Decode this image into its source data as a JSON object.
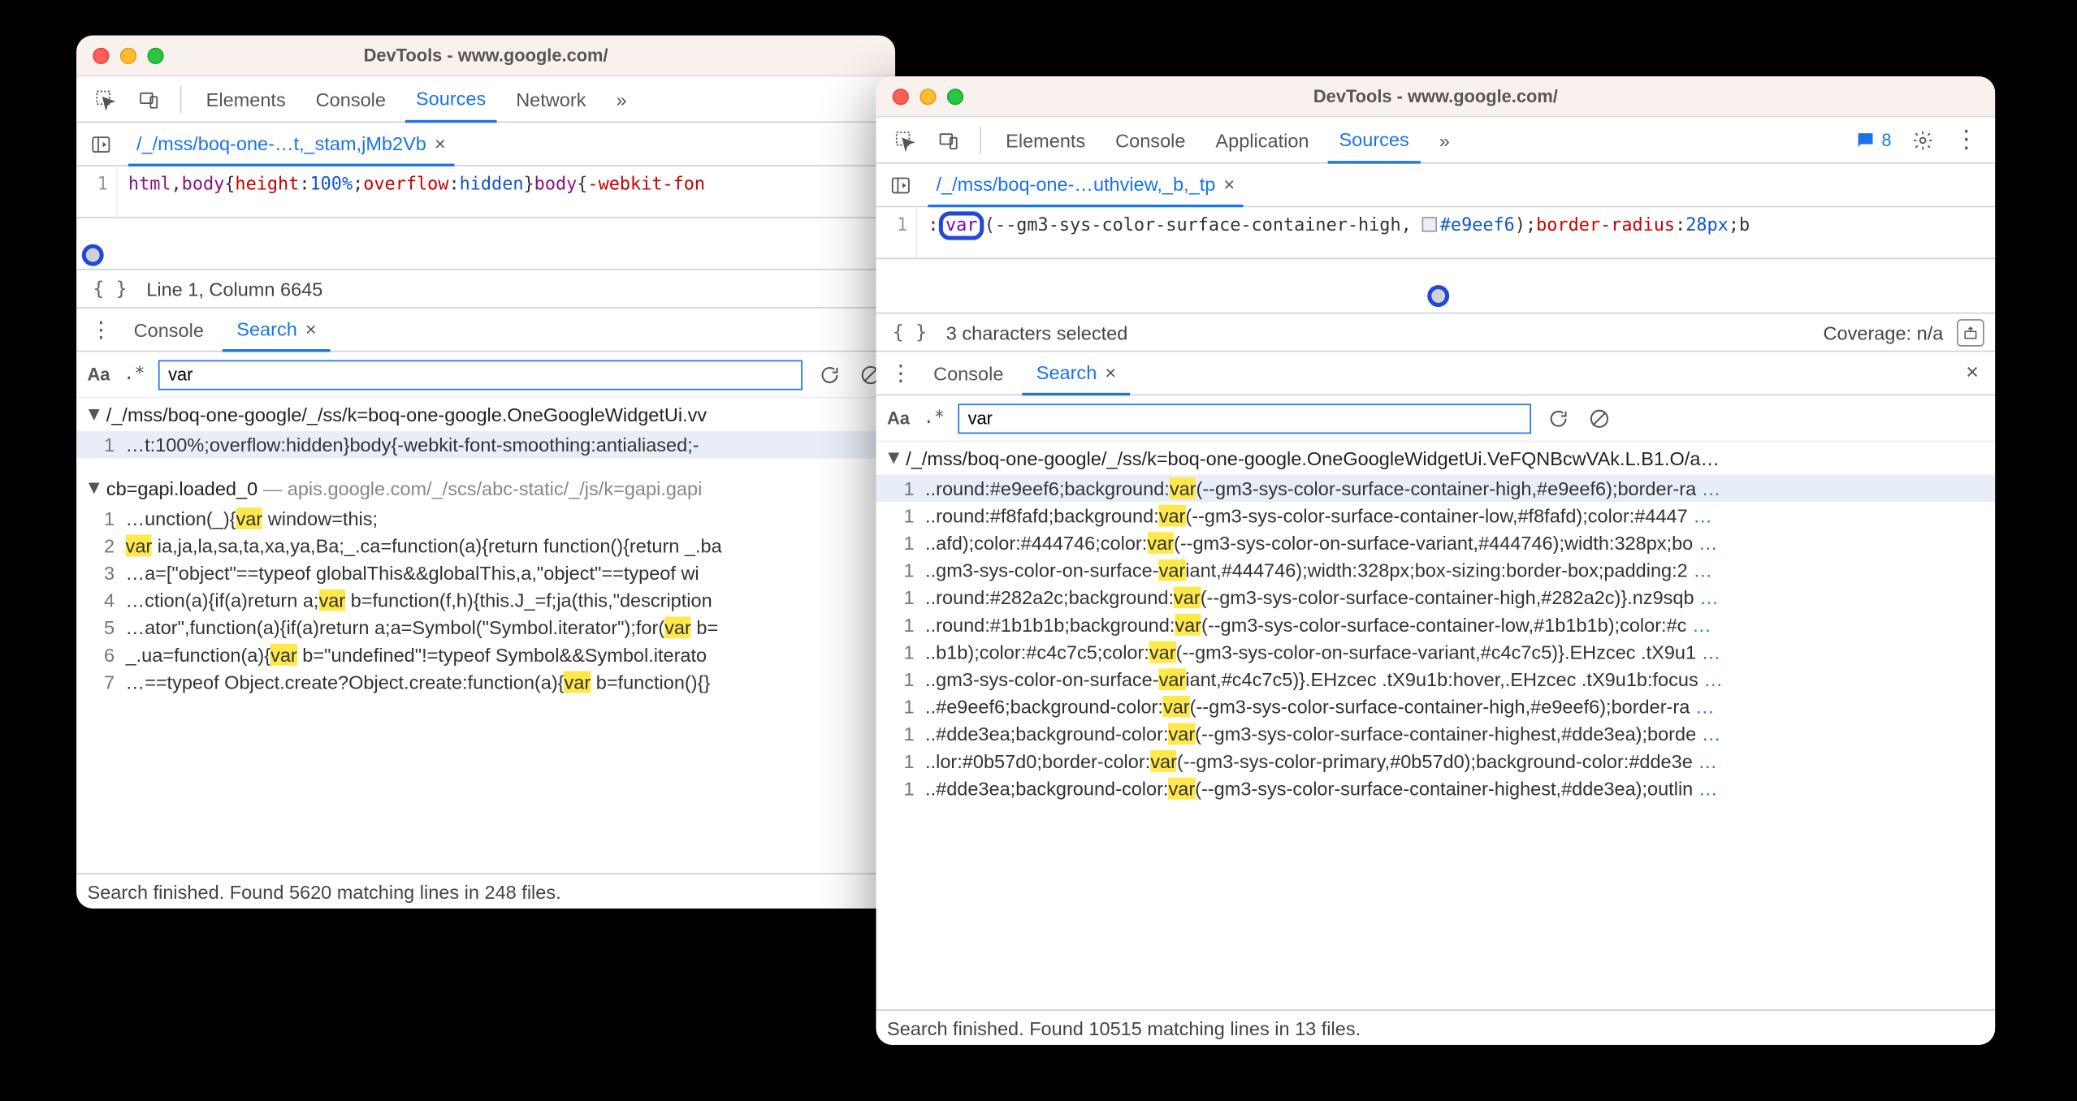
{
  "left_window": {
    "title": "DevTools - www.google.com/",
    "tabs": {
      "elements": "Elements",
      "console": "Console",
      "sources": "Sources",
      "network": "Network",
      "more": "»"
    },
    "file_tab": {
      "label": "/_/mss/boq-one-…t,_stam,jMb2Vb"
    },
    "code_line_number": "1",
    "status": {
      "text": "Line 1, Column 6645"
    },
    "drawer_tabs": {
      "console": "Console",
      "search": "Search"
    },
    "search": {
      "match_case": "Aa",
      "regex": ".*",
      "value": "var"
    },
    "result_files": {
      "f1": "/_/mss/boq-one-google/_/ss/k=boq-one-google.OneGoogleWidgetUi.vv",
      "f2": "cb=gapi.loaded_0",
      "f2_dim": " — apis.google.com/_/scs/abc-static/_/js/k=gapi.gapi"
    },
    "result_lines": {
      "r1_ln": "1",
      "r1_pre": "…t:100%;overflow:hidden}body{-webkit-font-smoothing:antialiased;-",
      "g1_ln": "1",
      "g1_pre": "…unction(_){",
      "g1_mid": " window=this;",
      "g2_ln": "2",
      "g2_mid": " ia,ja,la,sa,ta,xa,ya,Ba;_.ca=function(a){return function(){return _.ba",
      "g3_ln": "3",
      "g3_mid": "…a=[\"object\"==typeof globalThis&&globalThis,a,\"object\"==typeof wi",
      "g4_ln": "4",
      "g4_pre": "…ction(a){if(a)return a;",
      "g4_mid": " b=function(f,h){this.J_=f;ja(this,\"description",
      "g5_ln": "5",
      "g5_pre": "…ator\",function(a){if(a)return a;a=Symbol(\"Symbol.iterator\");for(",
      "g5_mid": " b=",
      "g6_ln": "6",
      "g6_pre": "_.ua=function(a){",
      "g6_mid": " b=\"undefined\"!=typeof Symbol&&Symbol.iterato",
      "g7_ln": "7",
      "g7_pre": "…==typeof Object.create?Object.create:function(a){",
      "g7_mid": " b=function(){}"
    },
    "footer": "Search finished.  Found 5620 matching lines in 248 files."
  },
  "right_window": {
    "title": "DevTools - www.google.com/",
    "tabs": {
      "elements": "Elements",
      "console": "Console",
      "application": "Application",
      "sources": "Sources",
      "more": "»"
    },
    "badge": {
      "count": "8"
    },
    "file_tab": {
      "label": "/_/mss/boq-one-…uthview,_b,_tp"
    },
    "code_line_number": "1",
    "code": {
      "var_token": "var",
      "after_var": "(--gm3-sys-color-surface-container-high,",
      "hex": "#e9eef6",
      "after_hex": ");",
      "prop2": "border-radius",
      "val2": "28px",
      "tail": ";b"
    },
    "status": {
      "text": "3 characters selected",
      "coverage": "Coverage: n/a"
    },
    "drawer_tabs": {
      "console": "Console",
      "search": "Search"
    },
    "search": {
      "match_case": "Aa",
      "regex": ".*",
      "value": "var"
    },
    "result_file": "/_/mss/boq-one-google/_/ss/k=boq-one-google.OneGoogleWidgetUi.VeFQNBcwVAk.L.B1.O/a…",
    "rows": {
      "r1_pre": "..round:#e9eef6;background:",
      "r1_post": "(--gm3-sys-color-surface-container-high,#e9eef6);border-ra",
      "r2_pre": "..round:#f8fafd;background:",
      "r2_post": "(--gm3-sys-color-surface-container-low,#f8fafd);color:#4447",
      "r3_pre": "..afd);color:#444746;color:",
      "r3_post": "(--gm3-sys-color-on-surface-variant,#444746);width:328px;bo",
      "r4_pre": "..gm3-sys-color-on-surface-",
      "r4_post": "iant,#444746);width:328px;box-sizing:border-box;padding:2",
      "r5_pre": "..round:#282a2c;background:",
      "r5_post": "(--gm3-sys-color-surface-container-high,#282a2c)}.nz9sqb",
      "r6_pre": "..round:#1b1b1b;background:",
      "r6_post": "(--gm3-sys-color-surface-container-low,#1b1b1b);color:#c",
      "r7_pre": "..b1b);color:#c4c7c5;color:",
      "r7_post": "(--gm3-sys-color-on-surface-variant,#c4c7c5)}.EHzcec .tX9u1",
      "r8_pre": "..gm3-sys-color-on-surface-",
      "r8_post": "iant,#c4c7c5)}.EHzcec .tX9u1b:hover,.EHzcec .tX9u1b:focus",
      "r9_pre": "..#e9eef6;background-color:",
      "r9_post": "(--gm3-sys-color-surface-container-high,#e9eef6);border-ra",
      "r10_pre": "..#dde3ea;background-color:",
      "r10_post": "(--gm3-sys-color-surface-container-highest,#dde3ea);borde",
      "r11_pre": "..lor:#0b57d0;border-color:",
      "r11_post": "(--gm3-sys-color-primary,#0b57d0);background-color:#dde3e",
      "r12_pre": "..#dde3ea;background-color:",
      "r12_post": "(--gm3-sys-color-surface-container-highest,#dde3ea);outlin"
    },
    "row_ln": "1",
    "footer": "Search finished.  Found 10515 matching lines in 13 files."
  }
}
